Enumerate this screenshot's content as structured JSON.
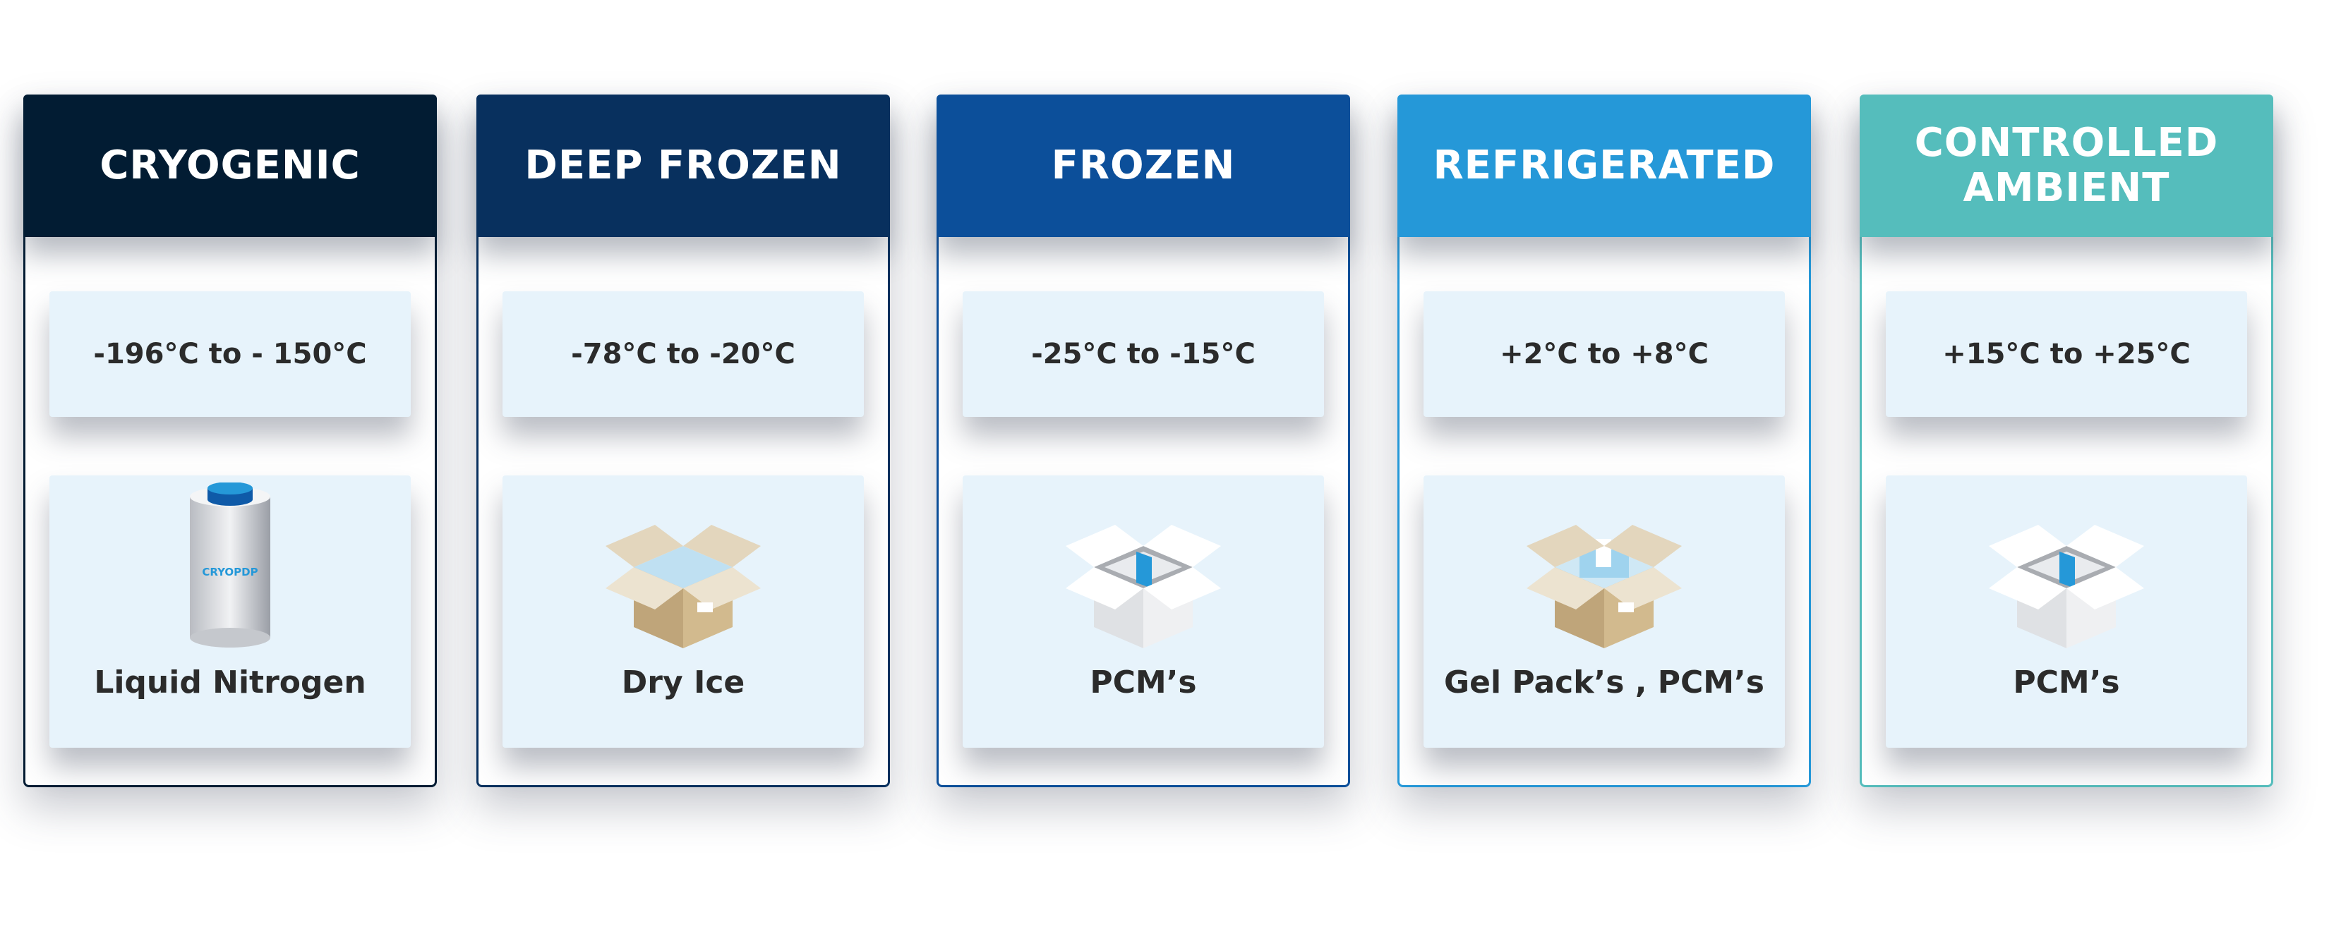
{
  "cards": [
    {
      "title": "CRYOGENIC",
      "temperature": "-196°C to - 150°C",
      "medium": "Liquid Nitrogen",
      "icon": "nitrogen-dewar",
      "icon_text": "CRYOPDP",
      "color": "#021c33"
    },
    {
      "title": "DEEP FROZEN",
      "temperature": "-78°C to -20°C",
      "medium": "Dry Ice",
      "icon": "dry-ice-box",
      "color": "#08305e"
    },
    {
      "title": "FROZEN",
      "temperature": "-25°C to -15°C",
      "medium": "PCM’s",
      "icon": "white-box",
      "color": "#0c4f9a"
    },
    {
      "title": "REFRIGERATED",
      "temperature": "+2°C to +8°C",
      "medium": "Gel Pack’s , PCM’s",
      "icon": "gel-pack-box",
      "color": "#2598d8"
    },
    {
      "title": "CONTROLLED\nAMBIENT",
      "temperature": "+15°C to +25°C",
      "medium": "PCM’s",
      "icon": "white-box",
      "color": "#55bdbc"
    }
  ]
}
